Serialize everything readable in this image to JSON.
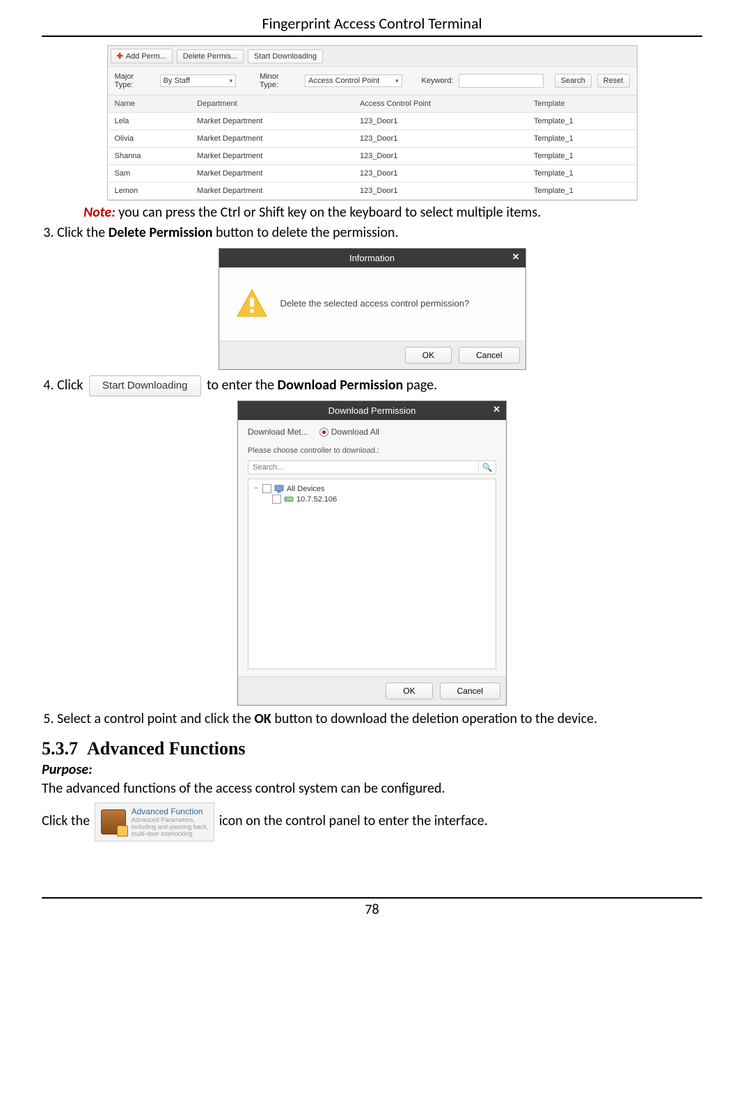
{
  "doc": {
    "header": "Fingerprint Access Control Terminal",
    "page_number": "78"
  },
  "body_text": {
    "note_prefix": "Note:",
    "note_rest": " you can press the Ctrl or Shift key on the keyboard to select multiple items.",
    "step3_a": "Click the ",
    "step3_b": "Delete Permission",
    "step3_c": " button to delete the permission.",
    "step4_a": "Click ",
    "step4_btn": "Start Downloading",
    "step4_b": " to enter the ",
    "step4_c": "Download Permission",
    "step4_d": " page.",
    "step5_a": "Select a control point and click the ",
    "step5_b": "OK",
    "step5_c": " button to download the deletion operation to the device.",
    "section_num": "5.3.7",
    "section_title": "Advanced Functions",
    "purpose_label": "Purpose:",
    "purpose_text": "The advanced functions of the access control system can be configured.",
    "adv_a": "Click the ",
    "adv_b": " icon on the control panel to enter the interface."
  },
  "s1": {
    "toolbar": {
      "add": "Add Perm...",
      "delete": "Delete Permis...",
      "start": "Start Downloading"
    },
    "filter": {
      "major_label": "Major Type:",
      "major_value": "By Staff",
      "minor_label": "Minor Type:",
      "minor_value": "Access Control Point",
      "keyword_label": "Keyword:",
      "search": "Search",
      "reset": "Reset"
    },
    "cols": [
      "Name",
      "Department",
      "Access Control Point",
      "Template"
    ],
    "rows": [
      {
        "c": [
          "Lela",
          "Market Department",
          "123_Door1",
          "Template_1"
        ]
      },
      {
        "c": [
          "Olivia",
          "Market Department",
          "123_Door1",
          "Template_1"
        ]
      },
      {
        "c": [
          "Shanna",
          "Market Department",
          "123_Door1",
          "Template_1"
        ]
      },
      {
        "c": [
          "Sam",
          "Market Department",
          "123_Door1",
          "Template_1"
        ]
      },
      {
        "c": [
          "Lemon",
          "Market Department",
          "123_Door1",
          "Template_1"
        ]
      }
    ]
  },
  "info_dialog": {
    "title": "Information",
    "message": "Delete the selected access control permission?",
    "ok": "OK",
    "cancel": "Cancel"
  },
  "dl_dialog": {
    "title": "Download Permission",
    "method_label": "Download Met...",
    "download_all": "Download All",
    "choose_label": "Please choose controller to download.:",
    "search_placeholder": "Search...",
    "tree_root": "All Devices",
    "tree_child": "10.7.52.106",
    "ok": "OK",
    "cancel": "Cancel"
  },
  "adv_tile": {
    "title": "Advanced Function",
    "line1": "Advanced Parameters,",
    "line2": "including anti-passing back,",
    "line3": "multi-door interlocking"
  }
}
